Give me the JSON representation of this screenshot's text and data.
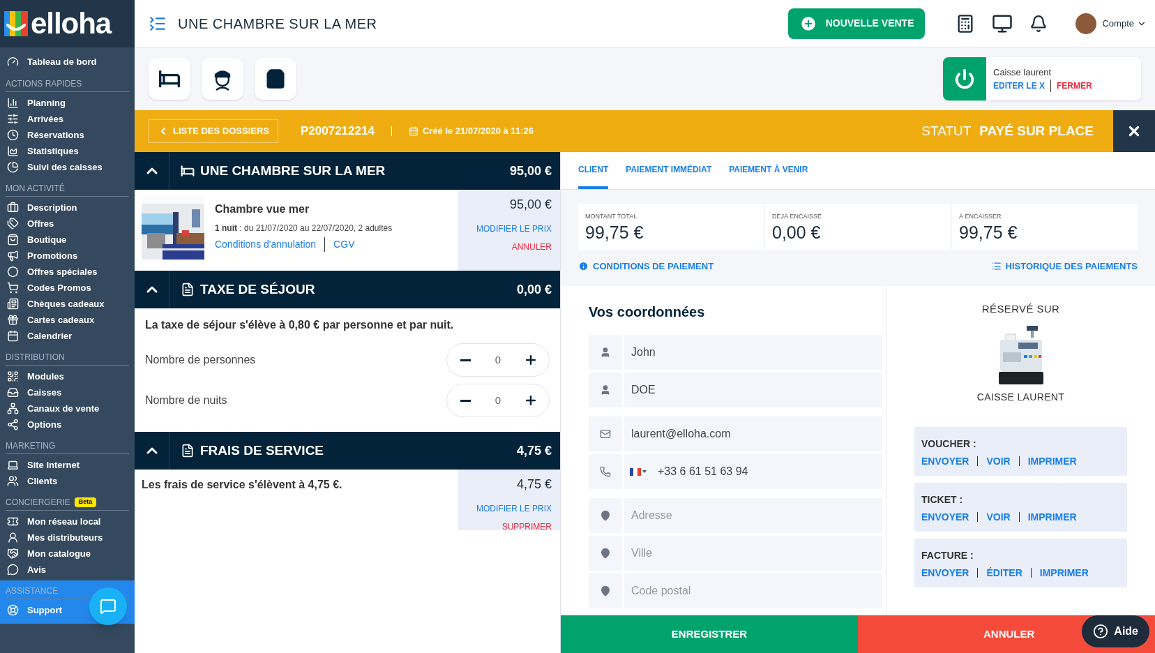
{
  "sidebar": {
    "logo": "elloha",
    "top_items": [
      {
        "label": "Tableau de bord"
      }
    ],
    "sections": [
      {
        "title": "ACTIONS RAPIDES",
        "highlighted": false,
        "items": [
          {
            "label": "Planning"
          },
          {
            "label": "Arrivées"
          },
          {
            "label": "Réservations"
          },
          {
            "label": "Statistiques"
          },
          {
            "label": "Suivi des caisses"
          }
        ]
      },
      {
        "title": "MON ACTIVITÉ",
        "highlighted": false,
        "items": [
          {
            "label": "Description"
          },
          {
            "label": "Offres"
          },
          {
            "label": "Boutique"
          },
          {
            "label": "Promotions"
          },
          {
            "label": "Offres spéciales"
          },
          {
            "label": "Codes Promos"
          },
          {
            "label": "Chèques cadeaux"
          },
          {
            "label": "Cartes cadeaux"
          },
          {
            "label": "Calendrier"
          }
        ]
      },
      {
        "title": "DISTRIBUTION",
        "highlighted": false,
        "items": [
          {
            "label": "Modules"
          },
          {
            "label": "Caisses"
          },
          {
            "label": "Canaux de vente"
          },
          {
            "label": "Options"
          }
        ]
      },
      {
        "title": "MARKETING",
        "highlighted": false,
        "items": [
          {
            "label": "Site Internet"
          },
          {
            "label": "Clients"
          }
        ]
      },
      {
        "title": "CONCIERGERIE",
        "badge": "Beta",
        "highlighted": false,
        "items": [
          {
            "label": "Mon réseau local"
          },
          {
            "label": "Mes distributeurs"
          },
          {
            "label": "Mon catalogue"
          },
          {
            "label": "Avis"
          }
        ]
      },
      {
        "title": "ASSISTANCE",
        "highlighted": true,
        "items": [
          {
            "label": "Support"
          }
        ]
      }
    ]
  },
  "top_bar": {
    "title": "UNE CHAMBRE SUR LA MER",
    "new_sale_button": "NOUVELLE VENTE",
    "account": "Compte"
  },
  "cash_register_card": {
    "name": "Caisse laurent",
    "actions": [
      {
        "label": "EDITER LE X",
        "kind": "primary"
      },
      {
        "label": "FERMER",
        "kind": "danger"
      }
    ]
  },
  "file_bar": {
    "back_button": "LISTE DES DOSSIERS",
    "reference": "P2007212214",
    "created": "Créé le 21/07/2020 à 11:26",
    "status_label": "STATUT",
    "status": "PAYÉ SUR PLACE"
  },
  "sections": [
    {
      "kind": "room",
      "title": "UNE CHAMBRE SUR LA MER",
      "amount": "95,00 €",
      "expanded": true,
      "item": {
        "name": "Chambre vue mer",
        "details": "**1 nuit** : du 21/07/2020 au 22/07/2020, 2 adultes",
        "links": [
          "Conditions d'annulation",
          "CGV"
        ],
        "price": "95,00 €",
        "actions": [
          {
            "label": "MODIFIER LE PRIX",
            "kind": "primary"
          },
          {
            "label": "ANNULER",
            "kind": "danger"
          }
        ]
      }
    },
    {
      "kind": "tax",
      "title": "TAXE DE SÉJOUR",
      "amount": "0,00 €",
      "expanded": true,
      "text": "La taxe de séjour s'élève à 0,80 € par personne et par nuit.",
      "counters": [
        {
          "label": "Nombre de personnes",
          "value": "0"
        },
        {
          "label": "Nombre de nuits",
          "value": "0"
        }
      ]
    },
    {
      "kind": "fee",
      "title": "FRAIS DE SERVICE",
      "amount": "4,75 €",
      "expanded": true,
      "text": "Les frais de service s'élèvent à 4,75 €.",
      "price": "4,75 €",
      "actions": [
        {
          "label": "MODIFIER LE PRIX",
          "kind": "primary"
        },
        {
          "label": "SUPPRIMER",
          "kind": "danger"
        }
      ]
    }
  ],
  "right_panel": {
    "tabs": [
      {
        "label": "CLIENT",
        "selected": true
      },
      {
        "label": "PAIEMENT IMMÉDIAT",
        "selected": false
      },
      {
        "label": "PAIEMENT À VENIR",
        "selected": false
      }
    ],
    "summary": [
      {
        "label": "MONTANT TOTAL",
        "value": "99,75 €"
      },
      {
        "label": "DÉJÀ ENCAISSÉ",
        "value": "0,00 €"
      },
      {
        "label": "À ENCAISSER",
        "value": "99,75 €"
      }
    ],
    "conditions_link": "CONDITIONS DE PAIEMENT",
    "history_link": "HISTORIQUE DES PAIEMENTS",
    "form": {
      "title": "Vos coordonnées",
      "groups": [
        [
          {
            "kind": "person",
            "value": "John"
          },
          {
            "kind": "person",
            "value": "DOE"
          }
        ],
        [
          {
            "kind": "email",
            "value": "laurent@elloha.com"
          },
          {
            "kind": "phone",
            "value": "+33 6 61 51 63 94"
          }
        ],
        [
          {
            "kind": "location",
            "placeholder": "Adresse"
          },
          {
            "kind": "location",
            "placeholder": "Ville"
          },
          {
            "kind": "location",
            "placeholder": "Code postal"
          }
        ]
      ]
    },
    "reserved": {
      "title": "RÉSERVÉ SUR",
      "register": "CAISSE LAURENT",
      "documents": [
        {
          "title": "VOUCHER :",
          "actions": [
            "ENVOYER",
            "VOIR",
            "IMPRIMER"
          ]
        },
        {
          "title": "TICKET :",
          "actions": [
            "ENVOYER",
            "VOIR",
            "IMPRIMER"
          ]
        },
        {
          "title": "FACTURE :",
          "actions": [
            "ENVOYER",
            "ÉDITER",
            "IMPRIMER"
          ]
        }
      ]
    },
    "save_button": "ENREGISTRER",
    "cancel_button": "ANNULER"
  },
  "help_button": "Aide"
}
